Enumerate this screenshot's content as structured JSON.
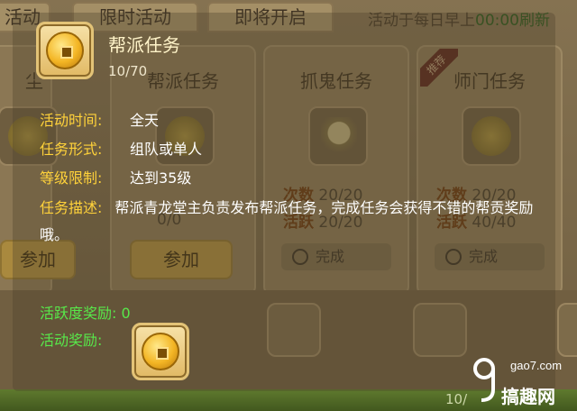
{
  "background": {
    "tabs": [
      "活动",
      "限时活动",
      "即将开启"
    ],
    "notice": "活动于每日早上",
    "notice_time": "00:00刷新",
    "panels": [
      {
        "title": "尘",
        "stat_lines": [],
        "status": "",
        "button": "参加"
      },
      {
        "title": "帮派任务",
        "stat_lines": [
          {
            "k": "",
            "v": "0/0"
          }
        ],
        "status": "",
        "button": "参加"
      },
      {
        "title": "抓鬼任务",
        "stat_lines": [
          {
            "k": "次数",
            "v": "20/20"
          },
          {
            "k": "活跃",
            "v": "20/20"
          }
        ],
        "status": "完成",
        "button": ""
      },
      {
        "title": "师门任务",
        "ribbon": "推荐",
        "stat_lines": [
          {
            "k": "次数",
            "v": "20/20"
          },
          {
            "k": "活跃",
            "v": "40/40"
          }
        ],
        "status": "完成",
        "button": ""
      }
    ],
    "bottom_bar_text": "10/"
  },
  "tooltip": {
    "item_icon": "gold-coin-icon",
    "title": "帮派任务",
    "count": "10/70",
    "rows": [
      {
        "label": "活动时间:",
        "value": "全天"
      },
      {
        "label": "任务形式:",
        "value": "组队或单人"
      },
      {
        "label": "等级限制:",
        "value": "达到35级"
      }
    ],
    "description_label": "任务描述:",
    "description": "帮派青龙堂主负责发布帮派任务，完成任务会获得不错的帮贡奖励哦。",
    "activity_reward_label": "活跃度奖励:",
    "activity_reward_value": "0",
    "reward_label": "活动奖励:",
    "reward_icon": "gold-coin-icon"
  },
  "watermark": {
    "site": "gao7.com",
    "name": "搞趣网"
  },
  "colors": {
    "label": "#ffd23a",
    "value": "#ffffff",
    "activity": "#58e84a",
    "title": "#fff3c8"
  }
}
